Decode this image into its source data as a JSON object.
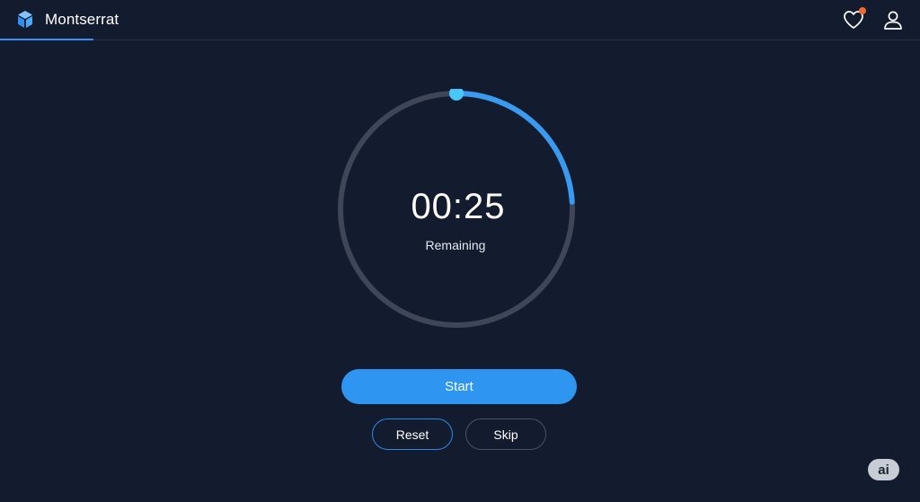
{
  "app": {
    "name": "Montserrat",
    "logo_icon": "hexagon-cube-logo-icon",
    "accent_color": "#2e95f0"
  },
  "header": {
    "favorites_icon": "heart-icon",
    "favorites_has_notification": true,
    "notification_color": "#f0692e",
    "profile_icon": "user-icon"
  },
  "timer": {
    "time": "00:25",
    "status_label": "Remaining",
    "progress_fraction": 0.24,
    "progress_color": "#3a9af0",
    "track_color": "#3f4657"
  },
  "controls": {
    "start_label": "Start",
    "reset_label": "Reset",
    "skip_label": "Skip"
  },
  "badge": {
    "label": "ai"
  }
}
